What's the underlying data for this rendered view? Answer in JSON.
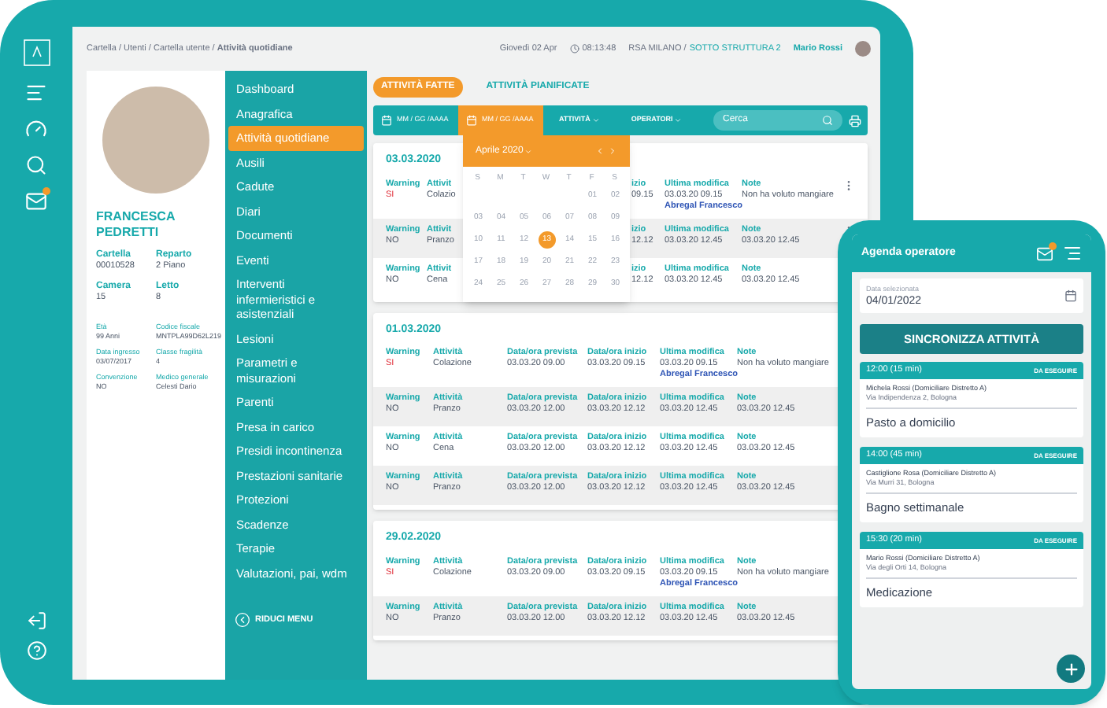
{
  "breadcrumb": "Cartella / Utenti / Cartella utente / **Attività quotidiane**",
  "header": {
    "date": "Giovedì 02 Apr",
    "time": "08:13:48",
    "facility": "RSA MILANO /",
    "substructure": "SOTTO STRUTTURA 2",
    "user": "Mario Rossi"
  },
  "patient": {
    "name": "FRANCESCA PEDRETTI",
    "main_fields": [
      {
        "label": "Cartella",
        "value": "00010528"
      },
      {
        "label": "Reparto",
        "value": "2 Piano"
      },
      {
        "label": "Camera",
        "value": "15"
      },
      {
        "label": "Letto",
        "value": "8"
      }
    ],
    "details": [
      {
        "label": "Età",
        "value": "99 Anni"
      },
      {
        "label": "Codice fiscale",
        "value": "MNTPLA99D62L219"
      },
      {
        "label": "Data ingresso",
        "value": "03/07/2017"
      },
      {
        "label": "Classe fragilità",
        "value": "4"
      },
      {
        "label": "Convenzione",
        "value": "NO"
      },
      {
        "label": "Medico generale",
        "value": "Celesti Dario"
      }
    ]
  },
  "menu": {
    "items": [
      {
        "label": "Dashboard",
        "selected": false
      },
      {
        "label": "Anagrafica",
        "selected": false
      },
      {
        "label": "Attività quotidiane",
        "selected": true
      },
      {
        "label": "Ausili",
        "selected": false
      },
      {
        "label": "Cadute",
        "selected": false
      },
      {
        "label": "Diari",
        "selected": false
      },
      {
        "label": "Documenti",
        "selected": false
      },
      {
        "label": "Eventi",
        "selected": false
      },
      {
        "label": "Interventi infermieristici e asistenziali",
        "selected": false
      },
      {
        "label": "Lesioni",
        "selected": false
      },
      {
        "label": "Parametri e misurazioni",
        "selected": false
      },
      {
        "label": "Parenti",
        "selected": false
      },
      {
        "label": "Presa in carico",
        "selected": false
      },
      {
        "label": "Presidi incontinenza",
        "selected": false
      },
      {
        "label": "Prestazioni sanitarie",
        "selected": false
      },
      {
        "label": "Protezioni",
        "selected": false
      },
      {
        "label": "Scadenze",
        "selected": false
      },
      {
        "label": "Terapie",
        "selected": false
      },
      {
        "label": "Valutazioni, pai, wdm",
        "selected": false
      }
    ],
    "collapse": "RIDUCI MENU"
  },
  "tabs": [
    {
      "label": "ATTIVITÀ FATTE",
      "selected": true
    },
    {
      "label": "ATTIVITÀ PIANIFICATE",
      "selected": false
    }
  ],
  "toolbar": {
    "date_fields": [
      {
        "placeholder": "MM / GG /AAAA",
        "open": false
      },
      {
        "placeholder": "MM / GG /AAAA",
        "open": true
      }
    ],
    "filters": [
      {
        "label": "ATTIVITÀ"
      },
      {
        "label": "OPERATORI"
      }
    ],
    "search": {
      "placeholder": "Cerca"
    }
  },
  "calendar": {
    "month": "Aprile 2020",
    "weekdays": [
      "S",
      "M",
      "T",
      "W",
      "T",
      "F",
      "S"
    ],
    "weeks": [
      [
        {
          "label": "01",
          "selected": false
        },
        {
          "label": "02",
          "selected": false
        }
      ],
      [
        {
          "label": "03",
          "selected": false
        },
        {
          "label": "04",
          "selected": false
        },
        {
          "label": "05",
          "selected": false
        },
        {
          "label": "06",
          "selected": false
        },
        {
          "label": "07",
          "selected": false
        },
        {
          "label": "08",
          "selected": false
        },
        {
          "label": "09",
          "selected": false
        }
      ],
      [
        {
          "label": "10",
          "selected": false
        },
        {
          "label": "11",
          "selected": false
        },
        {
          "label": "12",
          "selected": false
        },
        {
          "label": "13",
          "selected": true
        },
        {
          "label": "14",
          "selected": false
        },
        {
          "label": "15",
          "selected": false
        },
        {
          "label": "16",
          "selected": false
        }
      ],
      [
        {
          "label": "17",
          "selected": false
        },
        {
          "label": "18",
          "selected": false
        },
        {
          "label": "19",
          "selected": false
        },
        {
          "label": "20",
          "selected": false
        },
        {
          "label": "21",
          "selected": false
        },
        {
          "label": "22",
          "selected": false
        },
        {
          "label": "23",
          "selected": false
        }
      ],
      [
        {
          "label": "24",
          "selected": false
        },
        {
          "label": "25",
          "selected": false
        },
        {
          "label": "26",
          "selected": false
        },
        {
          "label": "27",
          "selected": false
        },
        {
          "label": "28",
          "selected": false
        },
        {
          "label": "29",
          "selected": false
        },
        {
          "label": "30",
          "selected": false
        }
      ]
    ]
  },
  "groups": [
    {
      "date": "03.03.2020",
      "kind": "covered",
      "rows": [
        {
          "menu": true,
          "warning": {
            "label": "Warning",
            "value": "SI",
            "alert": true
          },
          "cells": [
            {
              "label": "Attivit",
              "value": "Colazio"
            },
            {
              "label": "izio",
              "value": "09.15"
            },
            {
              "label": "Ultima modifica",
              "value": "03.03.20 09.15",
              "author": "Abregal Francesco"
            },
            {
              "label": "Note",
              "value": "Non ha voluto mangiare"
            }
          ]
        },
        {
          "menu": true,
          "warning": {
            "label": "Warning",
            "value": "NO",
            "alert": false
          },
          "cells": [
            {
              "label": "Attivit",
              "value": "Pranzo"
            },
            {
              "label": "izio",
              "value": "12.12"
            },
            {
              "label": "Ultima modifica",
              "value": "03.03.20 12.45"
            },
            {
              "label": "Note",
              "value": "03.03.20 12.45"
            }
          ]
        },
        {
          "warning": {
            "label": "Warning",
            "value": "NO",
            "alert": false
          },
          "cells": [
            {
              "label": "Attivit",
              "value": "Cena"
            },
            {
              "label": "izio",
              "value": "12.12"
            },
            {
              "label": "Ultima modifica",
              "value": "03.03.20 12.45"
            },
            {
              "label": "Note",
              "value": "03.03.20 12.45"
            }
          ]
        }
      ]
    },
    {
      "date": "01.03.2020",
      "kind": "full",
      "rows": [
        {
          "warning": {
            "label": "Warning",
            "value": "SI",
            "alert": true
          },
          "cells": [
            {
              "label": "Attività",
              "value": "Colazione"
            },
            {
              "label": "Data/ora prevista",
              "value": "03.03.20 09.00"
            },
            {
              "label": "Data/ora inizio",
              "value": "03.03.20 09.15"
            },
            {
              "label": "Ultima modifica",
              "value": "03.03.20 09.15",
              "author": "Abregal Francesco"
            },
            {
              "label": "Note",
              "value": "Non ha voluto mangiare"
            }
          ]
        },
        {
          "warning": {
            "label": "Warning",
            "value": "NO",
            "alert": false
          },
          "cells": [
            {
              "label": "Attività",
              "value": "Pranzo"
            },
            {
              "label": "Data/ora prevista",
              "value": "03.03.20 12.00"
            },
            {
              "label": "Data/ora inizio",
              "value": "03.03.20 12.12"
            },
            {
              "label": "Ultima modifica",
              "value": "03.03.20 12.45"
            },
            {
              "label": "Note",
              "value": "03.03.20 12.45"
            }
          ]
        },
        {
          "warning": {
            "label": "Warning",
            "value": "NO",
            "alert": false
          },
          "cells": [
            {
              "label": "Attività",
              "value": "Cena"
            },
            {
              "label": "Data/ora prevista",
              "value": "03.03.20 12.00"
            },
            {
              "label": "Data/ora inizio",
              "value": "03.03.20 12.12"
            },
            {
              "label": "Ultima modifica",
              "value": "03.03.20 12.45"
            },
            {
              "label": "Note",
              "value": "03.03.20 12.45"
            }
          ]
        },
        {
          "warning": {
            "label": "Warning",
            "value": "NO",
            "alert": false
          },
          "cells": [
            {
              "label": "Attività",
              "value": "Pranzo"
            },
            {
              "label": "Data/ora prevista",
              "value": "03.03.20 12.00"
            },
            {
              "label": "Data/ora inizio",
              "value": "03.03.20 12.12"
            },
            {
              "label": "Ultima modifica",
              "value": "03.03.20 12.45"
            },
            {
              "label": "Note",
              "value": "03.03.20 12.45"
            }
          ]
        }
      ]
    },
    {
      "date": "29.02.2020",
      "kind": "full",
      "rows": [
        {
          "warning": {
            "label": "Warning",
            "value": "SI",
            "alert": true
          },
          "cells": [
            {
              "label": "Attività",
              "value": "Colazione"
            },
            {
              "label": "Data/ora prevista",
              "value": "03.03.20 09.00"
            },
            {
              "label": "Data/ora inizio",
              "value": "03.03.20 09.15"
            },
            {
              "label": "Ultima modifica",
              "value": "03.03.20 09.15",
              "author": "Abregal Francesco"
            },
            {
              "label": "Note",
              "value": "Non ha voluto mangiare"
            }
          ]
        },
        {
          "warning": {
            "label": "Warning",
            "value": "NO",
            "alert": false
          },
          "cells": [
            {
              "label": "Attività",
              "value": "Pranzo"
            },
            {
              "label": "Data/ora prevista",
              "value": "03.03.20 12.00"
            },
            {
              "label": "Data/ora inizio",
              "value": "03.03.20 12.12"
            },
            {
              "label": "Ultima modifica",
              "value": "03.03.20 12.45"
            },
            {
              "label": "Note",
              "value": "03.03.20 12.45"
            }
          ]
        }
      ]
    }
  ],
  "phone": {
    "title": "Agenda operatore",
    "date_label": "Data selezionata",
    "date": "04/01/2022",
    "sync_button": "SINCRONIZZA ATTIVITÀ",
    "appointments": [
      {
        "time": "12:00 (15 min)",
        "status": "DA ESEGUIRE",
        "patient": "Michela Rossi (Domiciliare Distretto A)",
        "address": "Via Indipendenza 2, Bologna",
        "activity": "Pasto a domicilio"
      },
      {
        "time": "14:00 (45 min)",
        "status": "DA ESEGUIRE",
        "patient": "Castiglione Rosa (Domiciliare Distretto A)",
        "address": "Via Murri 31, Bologna",
        "activity": "Bagno settimanale"
      },
      {
        "time": "15:30 (20 min)",
        "status": "DA ESEGUIRE",
        "patient": "Mario Rossi (Domiciliare Distretto A)",
        "address": "Via degli Orti 14, Bologna",
        "activity": "Medicazione"
      }
    ]
  }
}
